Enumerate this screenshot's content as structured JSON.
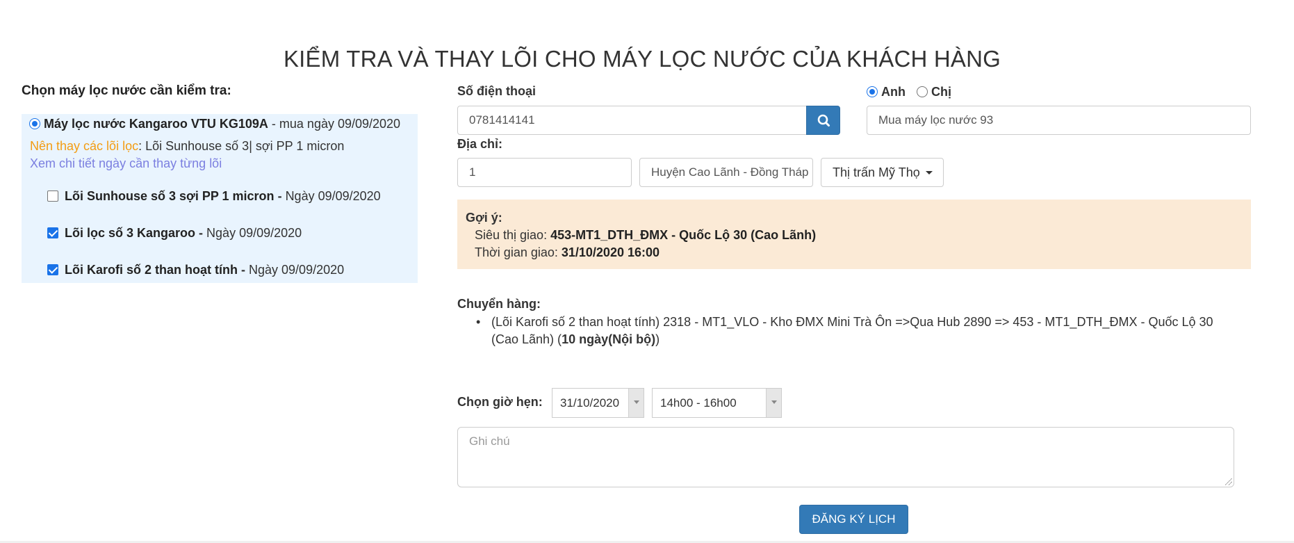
{
  "page": {
    "title": "KIỂM TRA VÀ THAY LÕI CHO MÁY LỌC NƯỚC CỦA KHÁCH HÀNG"
  },
  "left": {
    "heading": "Chọn máy lọc nước cần kiểm tra:",
    "machine": {
      "name": "Máy lọc nước Kangaroo VTU KG109A",
      "purchase": " - mua ngày 09/09/2020",
      "selected": true
    },
    "recommend_label": "Nên thay các lõi lọc",
    "recommend_value": ": Lõi Sunhouse số 3| sợi PP 1 micron",
    "detail_link": "Xem chi tiết ngày cần thay từng lõi",
    "filters": [
      {
        "name": "Lõi Sunhouse số 3 sợi PP 1 micron",
        "sep": " - ",
        "date": "Ngày 09/09/2020",
        "checked": false
      },
      {
        "name": "Lõi lọc số 3 Kangaroo",
        "sep": " - ",
        "date": "Ngày 09/09/2020",
        "checked": true
      },
      {
        "name": "Lõi Karofi số 2 than hoạt tính",
        "sep": " - ",
        "date": "Ngày 09/09/2020",
        "checked": true
      }
    ]
  },
  "form": {
    "phone_label": "Số điện thoại",
    "phone_value": "0781414141",
    "gender": {
      "male": "Anh",
      "female": "Chị",
      "selected": "Anh"
    },
    "customer_name": "Mua máy lọc nước 93",
    "address_label": "Địa chỉ:",
    "house_number": "1",
    "district": "Huyện Cao Lãnh - Đồng Tháp",
    "ward": "Thị trấn Mỹ Thọ"
  },
  "suggestion": {
    "title": "Gợi ý:",
    "store_label": "Siêu thị giao: ",
    "store_value": "453-MT1_DTH_ĐMX - Quốc Lộ 30 (Cao Lãnh)",
    "time_label": "Thời gian giao: ",
    "time_value": "31/10/2020 16:00"
  },
  "shipping": {
    "title": "Chuyển hàng:",
    "route_prefix": "(Lõi Karofi số 2 than hoạt tính) 2318 - MT1_VLO - Kho ĐMX Mini Trà Ôn =>Qua Hub 2890 => 453 - MT1_DTH_ĐMX - Quốc Lộ 30 (Cao Lãnh) (",
    "route_bold": "10 ngày(Nội bộ)",
    "route_suffix": ")"
  },
  "appointment": {
    "label": "Chọn giờ hẹn:",
    "date": "31/10/2020",
    "slot": "14h00 - 16h00",
    "note_placeholder": "Ghi chú",
    "submit": "ĐĂNG KÝ LỊCH"
  },
  "colors": {
    "primary": "#337ab7",
    "panel_blue": "#e9f4fe",
    "suggest_bg": "#fbead6",
    "recommend_orange": "#f39c12",
    "link_purple": "#7b7fe0"
  }
}
